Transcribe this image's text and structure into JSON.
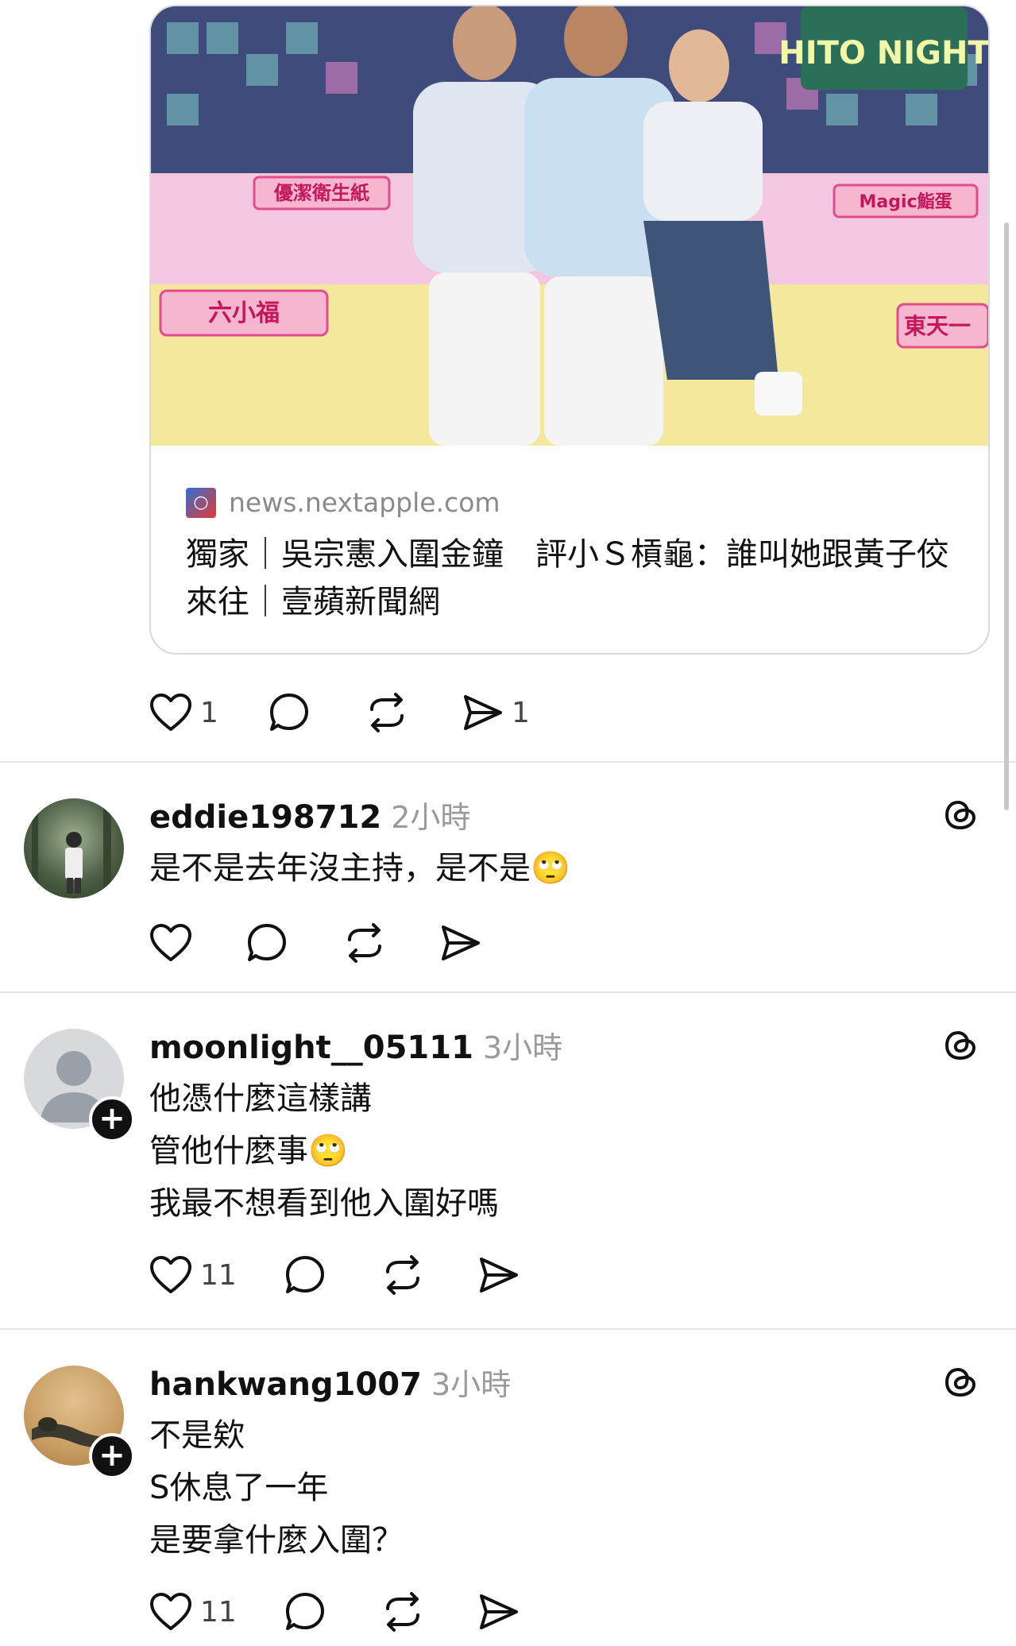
{
  "link_card": {
    "image_signs": {
      "top_right": "HITO NIGHT",
      "left_sign": "優潔衛生紙",
      "right_sign": "Magic鮨蛋",
      "lower_left_sign": "六小福",
      "lower_right_sign": "東天一"
    },
    "source_domain": "news.nextapple.com",
    "title": "獨家｜吳宗憲入圍金鐘　評小Ｓ槓龜：誰叫她跟黃子佼來往｜壹蘋新聞網"
  },
  "post_actions": {
    "like_count": "1",
    "share_count": "1"
  },
  "comments": [
    {
      "username": "eddie198712",
      "time": "2小時",
      "lines": [
        "是不是去年沒主持，是不是🙄"
      ],
      "like_count": "",
      "avatar": "photo-forest",
      "has_follow_badge": false
    },
    {
      "username": "moonlight__05111",
      "time": "3小時",
      "lines": [
        "他憑什麼這樣講",
        "管他什麼事🙄",
        "我最不想看到他入圍好嗎"
      ],
      "like_count": "11",
      "avatar": "default-avatar",
      "has_follow_badge": true
    },
    {
      "username": "hankwang1007",
      "time": "3小時",
      "lines": [
        "不是欸",
        "S休息了一年",
        "是要拿什麼入圍？"
      ],
      "like_count": "11",
      "avatar": "photo-sand",
      "has_follow_badge": true
    }
  ],
  "icons": {
    "like": "heart-icon",
    "reply": "speech-bubble-icon",
    "repost": "repost-icon",
    "share": "send-icon",
    "threads": "threads-logo-icon",
    "follow": "plus-icon"
  },
  "colors": {
    "text": "#111111",
    "muted": "#9a9a9a",
    "divider": "#e5e5e5"
  }
}
